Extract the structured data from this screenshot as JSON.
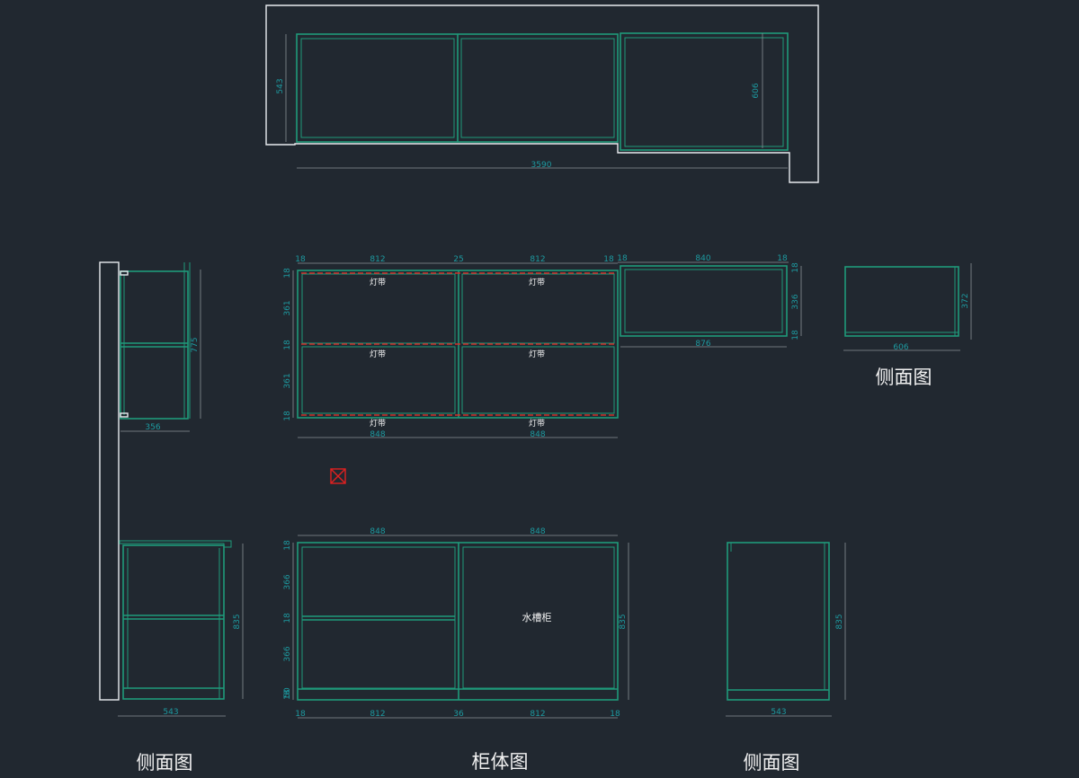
{
  "drawing": {
    "top_plan": {
      "width_overall": "3590",
      "depth_left": "543",
      "depth_right": "606"
    },
    "upper_front": {
      "widths_top": [
        "18",
        "812",
        "25",
        "812",
        "18"
      ],
      "heights_left": [
        "18",
        "361",
        "18",
        "361",
        "18"
      ],
      "widths_bottom": [
        "848",
        "848"
      ],
      "light_label": "灯带"
    },
    "upper_right": {
      "widths_top": [
        "18",
        "840",
        "18"
      ],
      "heights_right": [
        "18",
        "336",
        "18"
      ],
      "width_bottom": "876"
    },
    "upper_side_left": {
      "height": "775",
      "depth": "356"
    },
    "upper_side_right": {
      "height": "372",
      "depth": "606",
      "label": "侧面图"
    },
    "lower_front": {
      "widths_top": [
        "848",
        "848"
      ],
      "heights_left": [
        "18",
        "366",
        "18",
        "366",
        "50",
        "18"
      ],
      "height_right": "835",
      "widths_bottom": [
        "18",
        "812",
        "36",
        "812",
        "18"
      ],
      "sink_label": "水槽柜"
    },
    "lower_side_left": {
      "height": "835",
      "depth": "543",
      "label": "侧面图"
    },
    "lower_side_right": {
      "height": "835",
      "depth": "543",
      "label": "侧面图"
    },
    "main_title": "柜体图"
  }
}
